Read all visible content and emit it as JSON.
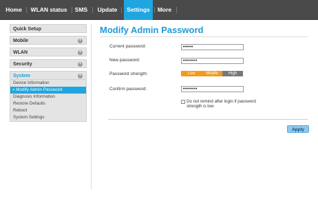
{
  "nav": {
    "tabs": [
      {
        "label": "Home",
        "active": false
      },
      {
        "label": "WLAN status",
        "active": false
      },
      {
        "label": "SMS",
        "active": false
      },
      {
        "label": "Update",
        "active": false
      },
      {
        "label": "Settings",
        "active": true
      },
      {
        "label": "More",
        "active": false
      }
    ]
  },
  "sidebar": {
    "sections": [
      {
        "label": "Quick Setup",
        "expand_icon": false
      },
      {
        "label": "Mobile",
        "expand_icon": true
      },
      {
        "label": "WLAN",
        "expand_icon": true
      },
      {
        "label": "Security",
        "expand_icon": true
      },
      {
        "label": "System",
        "expand_icon": true,
        "expanded": true
      }
    ],
    "system_items": [
      {
        "label": "Device Information",
        "active": false
      },
      {
        "label": "» Modify Admin Password",
        "active": true
      },
      {
        "label": "Diagnosis Information",
        "active": false
      },
      {
        "label": "Restore Defaults",
        "active": false
      },
      {
        "label": "Reboot",
        "active": false
      },
      {
        "label": "System Settings",
        "active": false
      }
    ]
  },
  "main": {
    "title": "Modify Admin Password",
    "current_label": "Current password:",
    "current_value": "•••••",
    "new_label": "New password:",
    "new_value": "•••••••",
    "strength_label": "Password strength:",
    "strength": {
      "low": "Low",
      "middle": "Middle",
      "high": "High",
      "level": "Middle"
    },
    "confirm_label": "Confirm password:",
    "confirm_value": "•••••••",
    "checkbox_label": "Do not remind after login if password strength is low",
    "checkbox_checked": false,
    "apply_label": "Apply"
  },
  "colors": {
    "accent": "#1fa6e0",
    "nav_bg": "#4a4a4a",
    "strength_active": "#f39a1a",
    "strength_inactive": "#777777"
  }
}
